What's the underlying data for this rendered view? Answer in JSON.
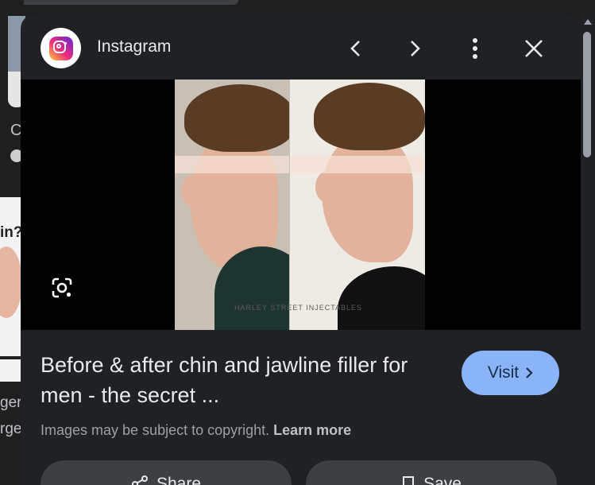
{
  "background": {
    "peek_letter": "C",
    "peek_thumb_text": "in?",
    "peek_text_1": "ger",
    "peek_text_2": "rge"
  },
  "header": {
    "source_name": "Instagram",
    "icons": [
      "instagram-logo",
      "chevron-left-icon",
      "chevron-right-icon",
      "more-vert-icon",
      "close-icon"
    ]
  },
  "image": {
    "watermark": "HARLEY STREET INJECTABLES",
    "lens_icon": "google-lens-icon"
  },
  "info": {
    "title": "Before & after chin and jawline filler for men - the secret ...",
    "visit_label": "Visit",
    "copyright_text": "Images may be subject to copyright.",
    "learn_more": "Learn more"
  },
  "actions": {
    "share_label": "Share",
    "save_label": "Save"
  },
  "colors": {
    "panel_bg": "#202124",
    "visit_bg": "#8ab4f8",
    "action_bg": "#3c4043"
  }
}
